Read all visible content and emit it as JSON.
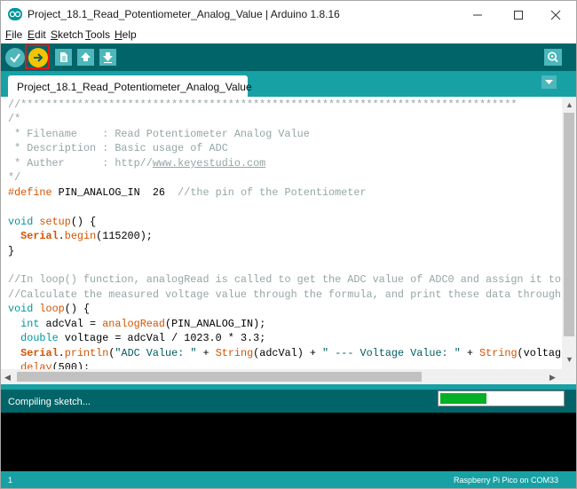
{
  "window": {
    "title": "Project_18.1_Read_Potentiometer_Analog_Value | Arduino 1.8.16"
  },
  "menu": [
    {
      "label": "File",
      "key": "F",
      "rest": "ile"
    },
    {
      "label": "Edit",
      "key": "E",
      "rest": "dit"
    },
    {
      "label": "Sketch",
      "key": "S",
      "rest": "ketch"
    },
    {
      "label": "Tools",
      "key": "T",
      "rest": "ools"
    },
    {
      "label": "Help",
      "key": "H",
      "rest": "elp"
    }
  ],
  "toolbar": {
    "icons": [
      "verify-check-icon",
      "upload-arrow-icon",
      "new-file-icon",
      "open-up-arrow-icon",
      "save-down-arrow-icon",
      "serial-monitor-icon"
    ]
  },
  "tab": {
    "label": "Project_18.1_Read_Potentiometer_Analog_Value"
  },
  "code": {
    "l1": "//*******************************************************************************",
    "l2": "/*",
    "l3a": " * Filename    : Read Potentiometer Analog Value",
    "l4a": " * Description : Basic usage of ADC",
    "l5a": " * Auther      : http//",
    "l5b": "www.keyestudio.com",
    "l6": "*/",
    "l7a": "#define",
    "l7b": " PIN_ANALOG_IN  26  ",
    "l7c": "//the pin of the Potentiometer",
    "l9a": "void",
    "l9b": " ",
    "l9c": "setup",
    "l9d": "() {",
    "l10a": "  ",
    "l10b": "Serial",
    "l10c": ".",
    "l10d": "begin",
    "l10e": "(115200);",
    "l11": "}",
    "l13": "//In loop() function, analogRead is called to get the ADC value of ADC0 and assign it to a",
    "l14": "//Calculate the measured voltage value through the formula, and print these data through the",
    "l15a": "void",
    "l15b": " ",
    "l15c": "loop",
    "l15d": "() {",
    "l16a": "  ",
    "l16b": "int",
    "l16c": " adcVal = ",
    "l16d": "analogRead",
    "l16e": "(PIN_ANALOG_IN);",
    "l17a": "  ",
    "l17b": "double",
    "l17c": " voltage = adcVal / 1023.0 * 3.3;",
    "l18a": "  ",
    "l18b": "Serial",
    "l18c": ".",
    "l18d": "println",
    "l18e": "(",
    "l18f": "\"ADC Value: \"",
    "l18g": " + ",
    "l18h": "String",
    "l18i": "(adcVal) + ",
    "l18j": "\" --- Voltage Value: \"",
    "l18k": " + ",
    "l18l": "String",
    "l18m": "(voltage",
    "l19a": "  ",
    "l19b": "delay",
    "l19c": "(500);"
  },
  "status": {
    "text": "Compiling sketch...",
    "progress": 0.38
  },
  "footer": {
    "line": "1",
    "board": "Raspberry Pi Pico on COM33"
  },
  "colors": {
    "toolbar": "#006468",
    "tabbar": "#17a1a5",
    "button": "#4db7bb",
    "upload_active": "#f5c400",
    "progress": "#06b025"
  }
}
